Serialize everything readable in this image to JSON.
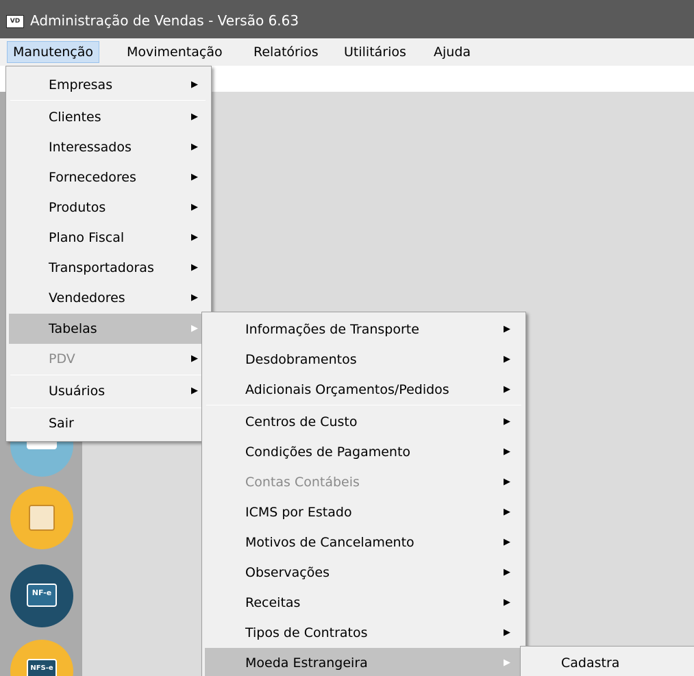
{
  "window": {
    "title": "Administração de Vendas - Versão 6.63",
    "icon_text": "VD"
  },
  "menubar": [
    {
      "label": "Manutenção"
    },
    {
      "label": "Movimentação"
    },
    {
      "label": "Relatórios"
    },
    {
      "label": "Utilitários"
    },
    {
      "label": "Ajuda"
    }
  ],
  "menu_manutencao": {
    "items": [
      {
        "label": "Empresas"
      },
      {
        "label": "Clientes"
      },
      {
        "label": "Interessados"
      },
      {
        "label": "Fornecedores"
      },
      {
        "label": "Produtos"
      },
      {
        "label": "Plano Fiscal"
      },
      {
        "label": "Transportadoras"
      },
      {
        "label": "Vendedores"
      },
      {
        "label": "Tabelas"
      },
      {
        "label": "PDV"
      },
      {
        "label": "Usuários"
      },
      {
        "label": "Sair"
      }
    ]
  },
  "menu_tabelas": {
    "items": [
      {
        "label": "Informações de Transporte"
      },
      {
        "label": "Desdobramentos"
      },
      {
        "label": "Adicionais Orçamentos/Pedidos"
      },
      {
        "label": "Centros de Custo"
      },
      {
        "label": "Condições de Pagamento"
      },
      {
        "label": "Contas Contábeis"
      },
      {
        "label": "ICMS por Estado"
      },
      {
        "label": "Motivos de Cancelamento"
      },
      {
        "label": "Observações"
      },
      {
        "label": "Receitas"
      },
      {
        "label": "Tipos de Contratos"
      },
      {
        "label": "Moeda Estrangeira"
      }
    ]
  },
  "menu_moeda": {
    "items": [
      {
        "label": "Cadastra"
      }
    ]
  },
  "strip_icons": [
    {
      "name": "notes-icon",
      "text": ""
    },
    {
      "name": "document-edit-icon",
      "text": ""
    },
    {
      "name": "nfe-laptop-icon",
      "text": "NF-e"
    },
    {
      "name": "nfse-laptop-icon",
      "text": "NFS-e"
    }
  ],
  "colors": {
    "titlebar": "#5a5a5a",
    "menu_bg": "#f0f0f0",
    "selected_item": "#c2c2c2",
    "menubar_active": "#cce0f5",
    "strip": "#ababab"
  }
}
